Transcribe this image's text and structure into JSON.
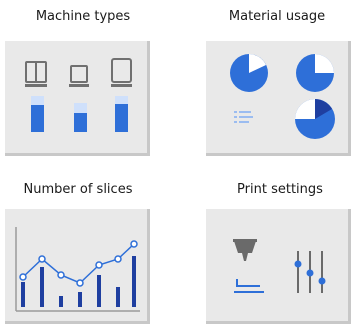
{
  "tiles": [
    {
      "label": "Machine types",
      "icon": "machine-types-icon"
    },
    {
      "label": "Material usage",
      "icon": "material-usage-icon"
    },
    {
      "label": "Number of slices",
      "icon": "slices-chart-icon"
    },
    {
      "label": "Print settings",
      "icon": "print-settings-icon"
    }
  ],
  "colors": {
    "accent": "#2e6fd8",
    "accent_dark": "#1f3fa0",
    "accent_light": "#cfe0fb",
    "card_bg": "#e9e9e9",
    "card_shadow": "#c8c8c8",
    "icon_gray": "#6a6a6a"
  }
}
